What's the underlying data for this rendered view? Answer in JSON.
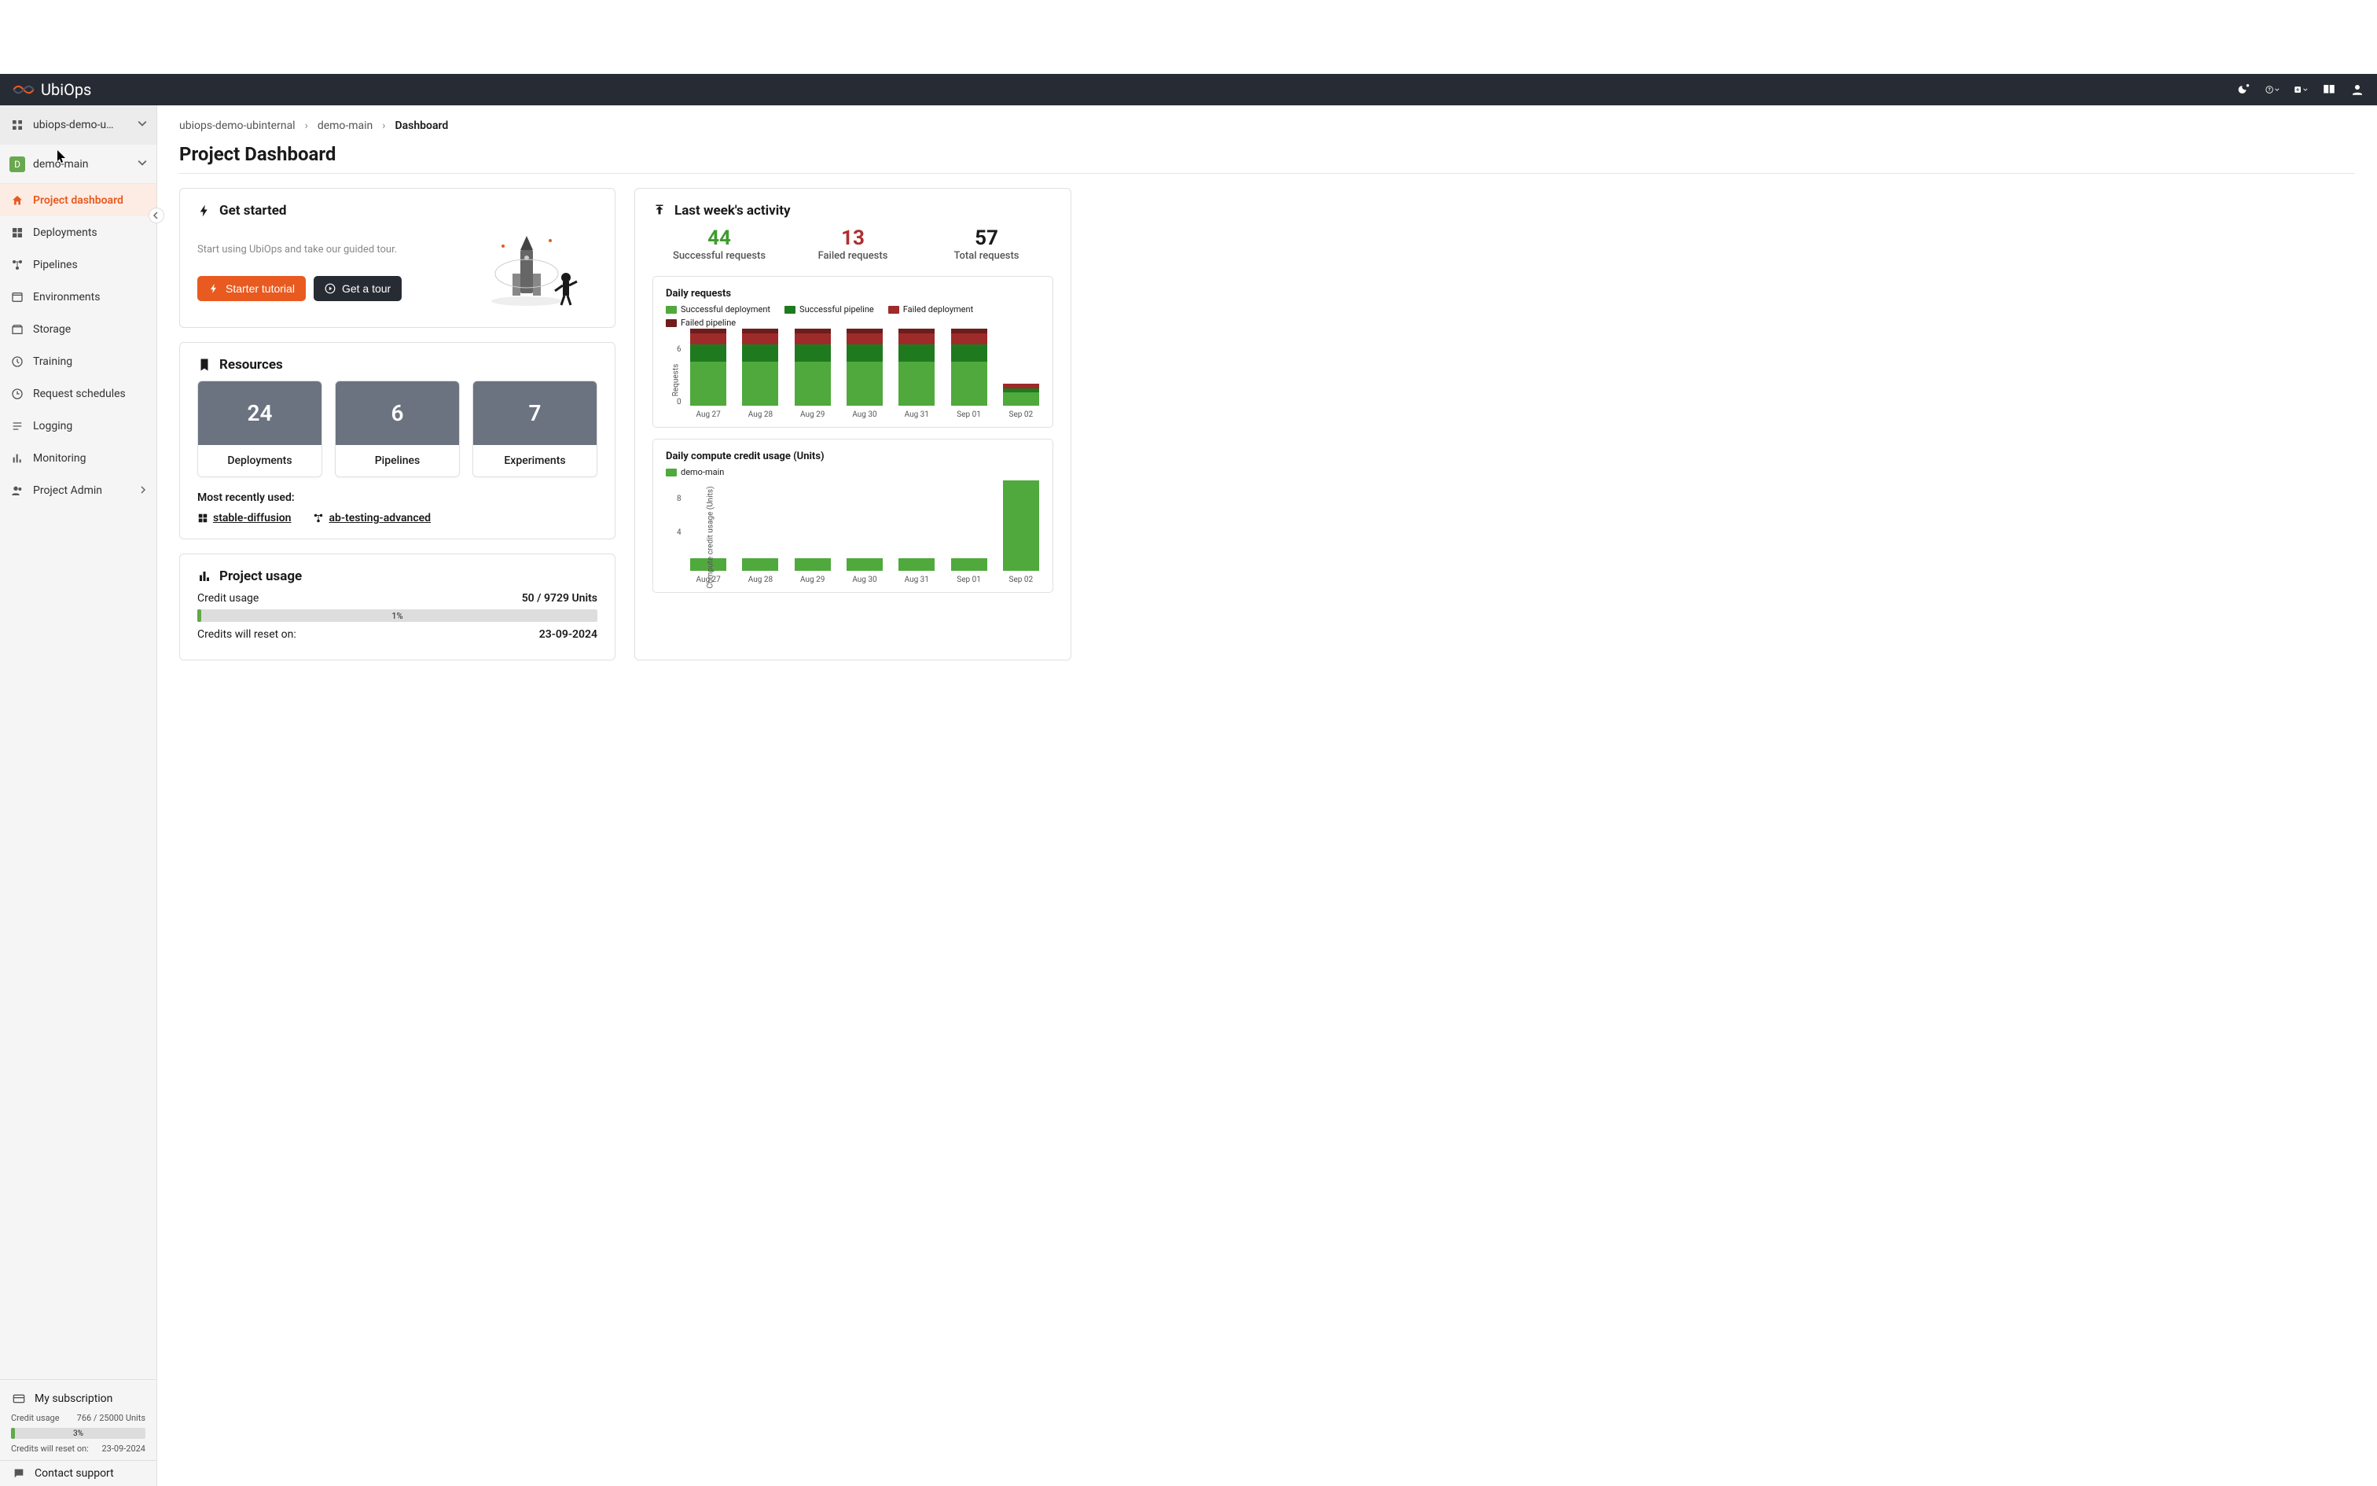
{
  "brand": "UbiOps",
  "sidebar": {
    "org_selector": "ubiops-demo-u…",
    "project_selector": "demo-main",
    "project_initial": "D",
    "items": [
      {
        "label": "Project dashboard"
      },
      {
        "label": "Deployments"
      },
      {
        "label": "Pipelines"
      },
      {
        "label": "Environments"
      },
      {
        "label": "Storage"
      },
      {
        "label": "Training"
      },
      {
        "label": "Request schedules"
      },
      {
        "label": "Logging"
      },
      {
        "label": "Monitoring"
      },
      {
        "label": "Project Admin"
      }
    ],
    "subscription": {
      "title": "My subscription",
      "credit_usage_label": "Credit usage",
      "credit_usage_value": "766 / 25000 Units",
      "percent": "3%",
      "reset_label": "Credits will reset on:",
      "reset_date": "23-09-2024"
    },
    "support": "Contact support"
  },
  "breadcrumb": {
    "org": "ubiops-demo-ubinternal",
    "project": "demo-main",
    "page": "Dashboard"
  },
  "page_title": "Project Dashboard",
  "get_started": {
    "title": "Get started",
    "subtitle": "Start using UbiOps and take our guided tour.",
    "starter_btn": "Starter tutorial",
    "tour_btn": "Get a tour"
  },
  "resources": {
    "title": "Resources",
    "tiles": [
      {
        "count": "24",
        "label": "Deployments"
      },
      {
        "count": "6",
        "label": "Pipelines"
      },
      {
        "count": "7",
        "label": "Experiments"
      }
    ],
    "recent_label": "Most recently used:",
    "recent": [
      {
        "name": "stable-diffusion",
        "type": "deployment"
      },
      {
        "name": "ab-testing-advanced",
        "type": "pipeline"
      }
    ]
  },
  "activity": {
    "title": "Last week's activity",
    "stats": [
      {
        "value": "44",
        "label": "Successful requests",
        "class": "green"
      },
      {
        "value": "13",
        "label": "Failed requests",
        "class": "red"
      },
      {
        "value": "57",
        "label": "Total requests",
        "class": ""
      }
    ]
  },
  "usage": {
    "title": "Project usage",
    "credit_label": "Credit usage",
    "credit_value": "50 / 9729 Units",
    "percent": "1%",
    "reset_label": "Credits will reset on:",
    "reset_date": "23-09-2024"
  },
  "chart_data": [
    {
      "type": "bar",
      "title": "Daily requests",
      "ylabel": "Requests",
      "ylim": [
        0,
        9
      ],
      "yticks": [
        0,
        6
      ],
      "categories": [
        "Aug 27",
        "Aug 28",
        "Aug 29",
        "Aug 30",
        "Aug 31",
        "Sep 01",
        "Sep 02"
      ],
      "series": [
        {
          "name": "Successful deployment",
          "color": "#50a93d",
          "values": [
            5.0,
            5.0,
            5.0,
            5.0,
            5.0,
            5.0,
            1.5
          ]
        },
        {
          "name": "Successful pipeline",
          "color": "#1f7a1f",
          "values": [
            2.0,
            2.0,
            2.0,
            2.0,
            2.0,
            2.0,
            0.5
          ]
        },
        {
          "name": "Failed deployment",
          "color": "#9e2a2a",
          "values": [
            1.3,
            1.3,
            1.3,
            1.3,
            1.3,
            1.3,
            0.5
          ]
        },
        {
          "name": "Failed pipeline",
          "color": "#6e1c1c",
          "values": [
            0.5,
            0.5,
            0.5,
            0.5,
            0.5,
            0.5,
            0.0
          ]
        }
      ]
    },
    {
      "type": "bar",
      "title": "Daily compute credit usage (Units)",
      "ylabel": "Compute credit usage (Units)",
      "ylim": [
        0,
        11
      ],
      "yticks": [
        4,
        8
      ],
      "categories": [
        "Aug 27",
        "Aug 28",
        "Aug 29",
        "Aug 30",
        "Aug 31",
        "Sep 01",
        "Sep 02"
      ],
      "series": [
        {
          "name": "demo-main",
          "color": "#50a93d",
          "values": [
            1.5,
            1.5,
            1.5,
            1.5,
            1.5,
            1.5,
            10.5
          ]
        }
      ]
    }
  ]
}
